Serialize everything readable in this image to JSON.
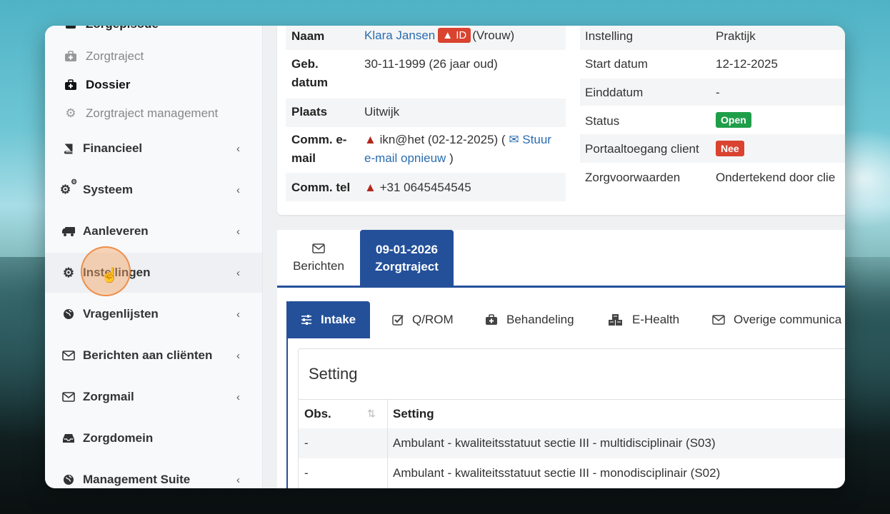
{
  "sidebar": {
    "top_partial": "Zorgepisode",
    "sub_items": [
      {
        "label": "Zorgtraject",
        "icon": "medkit-icon"
      },
      {
        "label": "Dossier",
        "icon": "medkit-icon",
        "active": true
      },
      {
        "label": "Zorgtraject management",
        "icon": "gear-icon"
      }
    ],
    "items": [
      {
        "label": "Financieel",
        "icon": "book-icon"
      },
      {
        "label": "Systeem",
        "icon": "cogs-icon"
      },
      {
        "label": "Aanleveren",
        "icon": "truck-icon"
      },
      {
        "label": "Instellingen",
        "icon": "gear-icon"
      },
      {
        "label": "Vragenlijsten",
        "icon": "globe-icon"
      },
      {
        "label": "Berichten aan cliënten",
        "icon": "envelope-icon"
      },
      {
        "label": "Zorgmail",
        "icon": "envelope-icon"
      },
      {
        "label": "Zorgdomein",
        "icon": "inbox-icon"
      },
      {
        "label": "Management Suite",
        "icon": "globe-icon"
      }
    ],
    "chevron": "‹"
  },
  "client": {
    "naam_label": "Naam",
    "naam_value": "Klara Jansen",
    "id_badge": "ID",
    "gender": "(Vrouw)",
    "geb_label_1": "Geb.",
    "geb_label_2": "datum",
    "geb_value": "30-11-1999 (26 jaar oud)",
    "plaats_label": "Plaats",
    "plaats_value": "Uitwijk",
    "email_label_1": "Comm. e-",
    "email_label_2": "mail",
    "email_value": "ikn@het (02-12-2025) (",
    "email_link_1": "Stuur",
    "email_link_2": "e-mail opnieuw",
    "email_close": ")",
    "tel_label": "Comm. tel",
    "tel_value": "+31 0645454545"
  },
  "traject": {
    "instelling_label": "Instelling",
    "instelling_value": "Praktijk",
    "start_label": "Start datum",
    "start_value": "12-12-2025",
    "eind_label": "Einddatum",
    "eind_value": "-",
    "status_label": "Status",
    "status_value": "Open",
    "portaal_label": "Portaaltoegang client",
    "portaal_value": "Nee",
    "voorwaarden_label": "Zorgvoorwaarden",
    "voorwaarden_value": "Ondertekend door clie"
  },
  "top_tabs": [
    {
      "label": "Berichten",
      "icon": "envelope-icon"
    },
    {
      "line1": "09-01-2026",
      "line2": "Zorgtraject",
      "active": true
    }
  ],
  "sub_tabs": [
    {
      "label": "Intake",
      "icon": "sliders-icon",
      "active": true
    },
    {
      "label": "Q/ROM",
      "icon": "check-square-icon"
    },
    {
      "label": "Behandeling",
      "icon": "medkit-icon"
    },
    {
      "label": "E-Health",
      "icon": "cubes-icon"
    },
    {
      "label": "Overige communica",
      "icon": "envelope-icon"
    }
  ],
  "setting_panel": {
    "title": "Setting",
    "columns": [
      "Obs.",
      "Setting"
    ],
    "rows": [
      [
        "-",
        "Ambulant - kwaliteitsstatuut sectie III - multidisciplinair (S03)"
      ],
      [
        "-",
        "Ambulant - kwaliteitsstatuut sectie III - monodisciplinair (S02)"
      ]
    ]
  }
}
